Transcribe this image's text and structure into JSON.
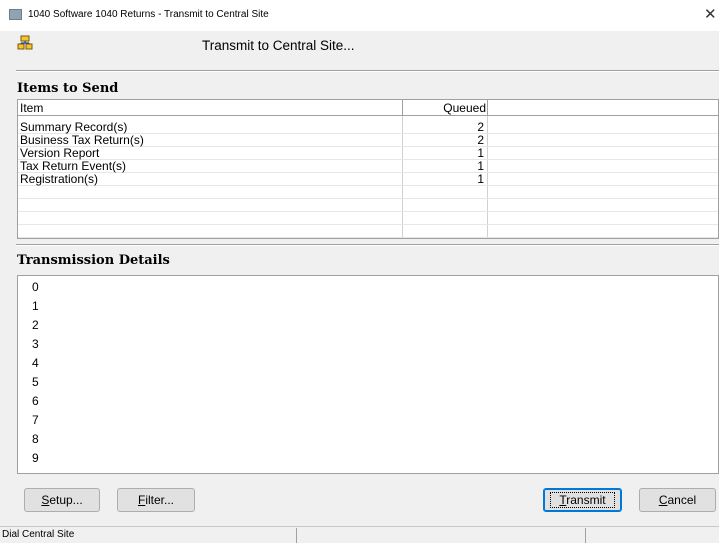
{
  "window": {
    "title": "1040 Software 1040 Returns - Transmit to Central Site",
    "close_glyph": "✕"
  },
  "header": {
    "icon": "transmit-network-icon",
    "text": "Transmit to Central Site..."
  },
  "items_section": {
    "title": "Items to Send",
    "columns": [
      "Item",
      "Queued"
    ],
    "rows": [
      {
        "item": "Summary Record(s)",
        "queued": "2"
      },
      {
        "item": "Business Tax Return(s)",
        "queued": "2"
      },
      {
        "item": "Version Report",
        "queued": "1"
      },
      {
        "item": "Tax Return Event(s)",
        "queued": "1"
      },
      {
        "item": "Registration(s)",
        "queued": "1"
      }
    ]
  },
  "details_section": {
    "title": "Transmission Details",
    "lines": [
      "0",
      "1",
      "2",
      "3",
      "4",
      "5",
      "6",
      "7",
      "8",
      "9"
    ]
  },
  "buttons": {
    "setup": {
      "pre": "",
      "mnemonic": "S",
      "post": "etup..."
    },
    "filter": {
      "pre": "",
      "mnemonic": "F",
      "post": "ilter..."
    },
    "transmit": {
      "pre": "",
      "mnemonic": "T",
      "post": "ransmit"
    },
    "cancel": {
      "pre": "",
      "mnemonic": "C",
      "post": "ancel"
    }
  },
  "status": {
    "text": "Dial Central Site"
  }
}
